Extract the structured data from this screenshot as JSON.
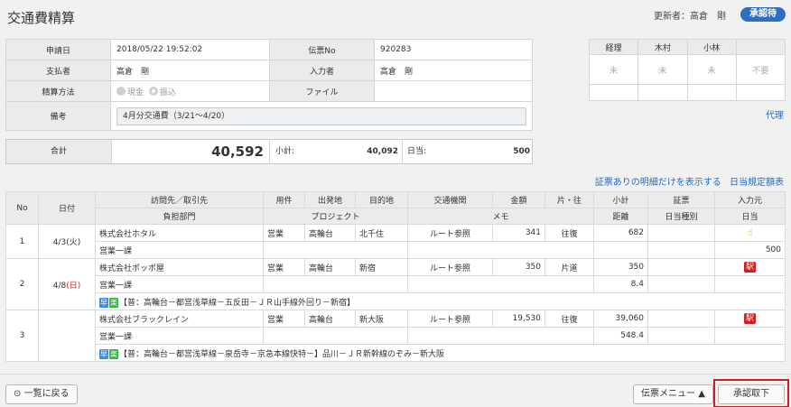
{
  "header": {
    "title": "交通費精算",
    "updater": "更新者：高倉　剛",
    "status": "承認待"
  },
  "info": {
    "application_date_label": "申請日",
    "application_date": "2018/05/22 19:52:02",
    "voucher_no_label": "伝票No",
    "voucher_no": "920283",
    "payer_label": "支払者",
    "payer": "高倉　剛",
    "entered_by_label": "入力者",
    "entered_by": "高倉　剛",
    "method_label": "精算方法",
    "method_cash": "現金",
    "method_transfer": "振込",
    "file_label": "ファイル",
    "note_label": "備考",
    "note": "4月分交通費（3/21～4/20）"
  },
  "approval": {
    "headers": [
      "経理",
      "木村",
      "小林",
      ""
    ],
    "values": [
      "未",
      "未",
      "未",
      "不要"
    ],
    "proxy_link": "代理"
  },
  "total": {
    "label": "合計",
    "amount": "40,592",
    "subtotal_label": "小計:",
    "subtotal": "40,092",
    "daily_label": "日当:",
    "daily": "500"
  },
  "links": {
    "receipts_only": "証票ありの明細だけを表示する",
    "daily_rules": "日当規定額表"
  },
  "detail": {
    "headers_top": [
      "No",
      "日付",
      "訪問先／取引先",
      "用件",
      "出発地",
      "目的地",
      "交通機関",
      "金額",
      "片・往",
      "小計",
      "証票",
      "入力元"
    ],
    "headers_bottom": [
      "負担部門",
      "プロジェクト",
      "メモ",
      "距離",
      "日当種別",
      "日当"
    ],
    "rows": [
      {
        "no": "1",
        "date": "4/3",
        "dow": "(火)",
        "client": "株式会社ホタル",
        "purpose": "営業",
        "from": "高輪台",
        "to": "北千住",
        "transport": "ルート参照",
        "amount": "341",
        "trip": "往復",
        "subtotal": "682",
        "dept": "営業一課",
        "daily": "500",
        "route": ""
      },
      {
        "no": "2",
        "date": "4/8",
        "dow": "(日)",
        "client": "株式会社ポッポ屋",
        "purpose": "営業",
        "from": "高輪台",
        "to": "新宿",
        "transport": "ルート参照",
        "amount": "350",
        "trip": "片道",
        "subtotal": "350",
        "dept": "営業一課",
        "distance": "8.4",
        "badge": "駅",
        "route_fast": "早",
        "route_cheap": "楽",
        "route": "【普：高輪台－都営浅草線－五反田－ＪＲ山手線外回り－新宿】"
      },
      {
        "no": "3",
        "date": "",
        "dow": "",
        "client": "株式会社ブラックレイン",
        "purpose": "営業",
        "from": "高輪台",
        "to": "新大阪",
        "transport": "ルート参照",
        "amount": "19,530",
        "trip": "往復",
        "subtotal": "39,060",
        "dept": "営業一課",
        "distance": "548.4",
        "badge": "駅",
        "route_fast": "早",
        "route_cheap": "楽",
        "route": "【普：高輪台－都営浅草線－泉岳寺－京急本線快特－】品川－ＪＲ新幹線のぞみ－新大阪"
      }
    ]
  },
  "footer": {
    "back": "一覧に戻る",
    "menu": "伝票メニュー",
    "withdraw": "承認取下"
  },
  "icons": {
    "back": "circle-left-arrow-icon",
    "menu": "caret-up-icon",
    "hand": "pointing-hand-icon"
  },
  "colors": {
    "accent": "#2f6fc3",
    "link": "#2a6ab8",
    "highlight": "#d01c1c"
  }
}
